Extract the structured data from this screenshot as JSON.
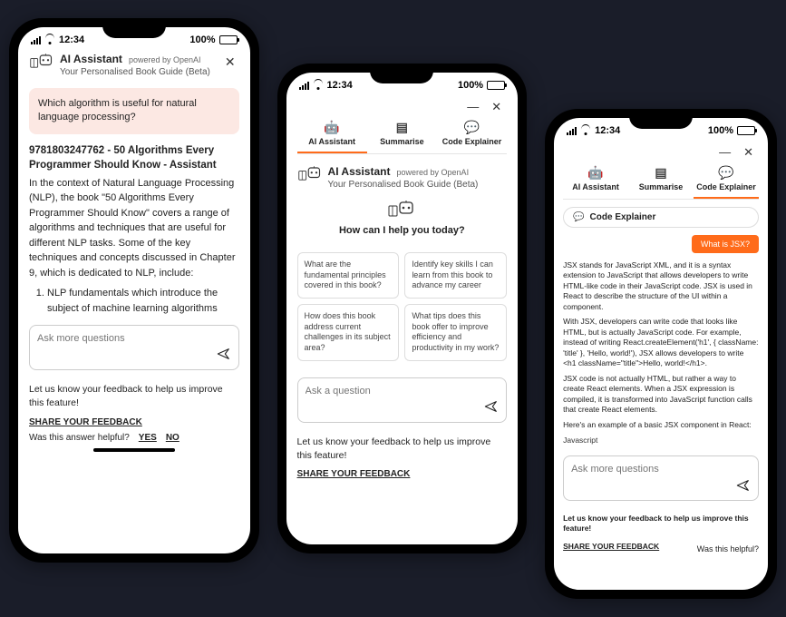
{
  "status": {
    "time": "12:34",
    "battery": "100%"
  },
  "header": {
    "title": "AI Assistant",
    "powered": "powered by OpenAI",
    "tagline": "Your Personalised Book Guide (Beta)"
  },
  "tabs": {
    "ai": "AI Assistant",
    "summarise": "Summarise",
    "code": "Code Explainer"
  },
  "p1": {
    "question": "Which algorithm is useful for natural language processing?",
    "answer_title": "9781803247762 - 50 Algorithms Every Programmer Should Know - Assistant",
    "answer_body": "In the context of Natural Language Processing (NLP), the book \"50 Algorithms Every Programmer Should Know\" covers a range of algorithms and techniques that are useful for different NLP tasks. Some of the key techniques and concepts discussed in Chapter 9, which is dedicated to NLP, include:",
    "answer_li1": "NLP fundamentals which introduce the subject of machine learning algorithms",
    "input_placeholder": "Ask more questions",
    "feedback_msg": "Let us know your feedback to help us improve this feature!",
    "feedback_link": "SHARE YOUR FEEDBACK",
    "helpful_q": "Was this answer helpful?",
    "yes": "YES",
    "no": "NO"
  },
  "p2": {
    "help_heading": "How can I help you today?",
    "s1": "What are the fundamental principles covered in this book?",
    "s2": "Identify key skills I can learn from this book to advance my career",
    "s3": "How does this book address current challenges in its subject area?",
    "s4": "What tips does this book offer to improve efficiency and productivity in my work?",
    "input_placeholder": "Ask a question",
    "feedback_msg": "Let us know your feedback to help us improve this feature!",
    "feedback_link": "SHARE YOUR FEEDBACK"
  },
  "p3": {
    "ce_label": "Code Explainer",
    "chip": "What is JSX?",
    "para1": "JSX stands for JavaScript XML, and it is a syntax extension to JavaScript that allows developers to write HTML-like code in their JavaScript code. JSX is used in React to describe the structure of the UI within a component.",
    "para2": "With JSX, developers can write code that looks like HTML, but is actually JavaScript code. For example, instead of writing React.createElement('h1', { className: 'title' }, 'Hello, world!'), JSX allows developers to write <h1 className=\"title\">Hello, world!</h1>.",
    "para3": "JSX code is not actually HTML, but rather a way to create React elements. When a JSX expression is compiled, it is transformed into JavaScript function calls that create React elements.",
    "para4": "Here's an example of a basic JSX component in React:",
    "lang": "Javascript",
    "input_placeholder": "Ask more questions",
    "feedback_msg": "Let us know your feedback to help us improve this feature!",
    "feedback_link": "SHARE YOUR FEEDBACK",
    "helpful_q": "Was this helpful?"
  }
}
